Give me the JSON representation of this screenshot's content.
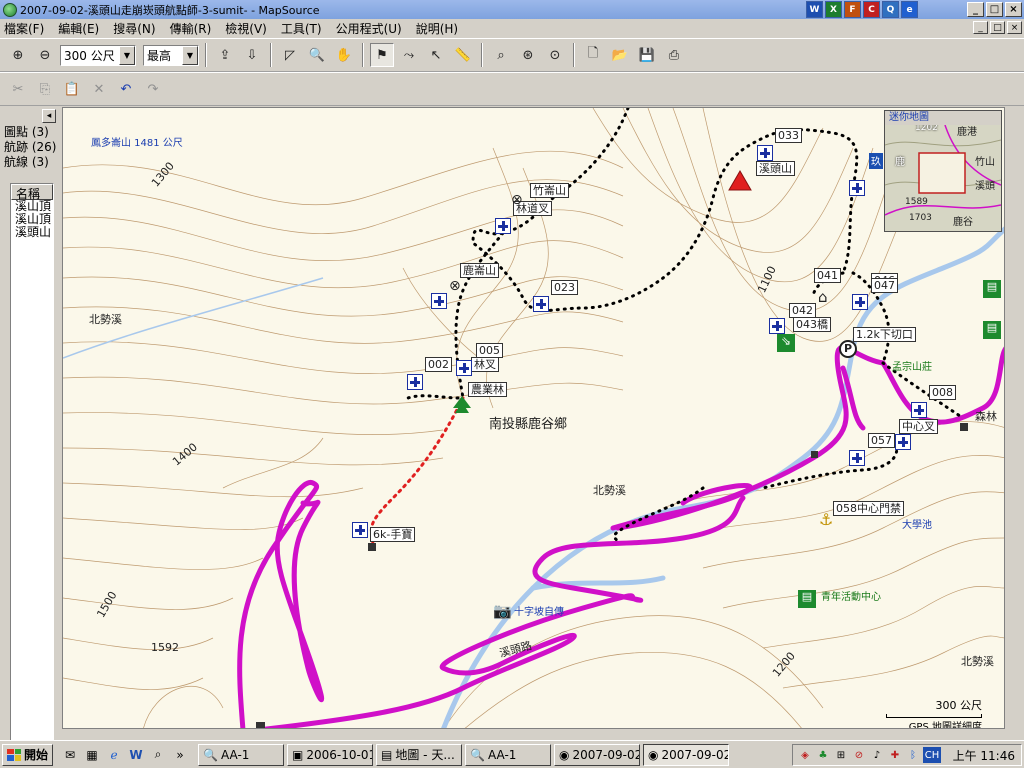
{
  "window": {
    "title": "2007-09-02-溪頭山走崩崁頭航點師-3-sumit- - MapSource",
    "min": "_",
    "max": "□",
    "close": "×"
  },
  "title_tray": [
    "W",
    "X",
    "F",
    "C",
    "Q",
    "e"
  ],
  "menu": [
    "檔案(F)",
    "編輯(E)",
    "搜尋(N)",
    "傳輸(R)",
    "檢視(V)",
    "工具(T)",
    "公用程式(U)",
    "說明(H)"
  ],
  "toolbar": {
    "zoom_value": "300 公尺",
    "detail_value": "最高"
  },
  "left_panel": {
    "tabs": [
      "圖點 (3)",
      "航跡 (26)",
      "航線 (3)"
    ],
    "list_header": "名稱",
    "list_items": [
      "溪山頂",
      "溪山頂",
      "溪頭山"
    ]
  },
  "map": {
    "places": {
      "peak_label": "鳳多崙山 1481 公尺",
      "contour_1300": "1300",
      "contour_1400": "1400",
      "contour_1500": "1500",
      "contour_1200": "1200",
      "contour_1100": "1100",
      "spot_height": "1592",
      "stream_west": "北勢溪",
      "stream_mid": "北勢溪",
      "stream_east": "北勢溪",
      "township": "南投縣鹿谷鄉",
      "road": "溪頭路"
    },
    "waypoints": {
      "w033": "033",
      "w023": "023",
      "w005": "005",
      "w002": "002",
      "w041": "041",
      "w042": "042",
      "w043": "043橋",
      "w046": "046",
      "w047": "047",
      "w008": "008",
      "w057": "057",
      "w058": "058中心門禁",
      "xitou": "溪頭山",
      "zhuqishan": "竹崙山",
      "linwen": "林道叉",
      "luling": "鹿崙山",
      "wen": "林叉",
      "chanlin": "農業林",
      "start": "6k-手寶",
      "trail_sign": "1.2k下切口",
      "center_wen": "中心叉",
      "fork": "森林"
    },
    "pois": {
      "hostel": "孟宗山莊",
      "pool": "大學池",
      "camera": "十字坡自傳",
      "youth": "青年活動中心"
    },
    "minimap": {
      "title": "迷你地圖",
      "labels": [
        "1202",
        "鹿港",
        "鹿",
        "竹山",
        "溪頭",
        "1589",
        "1703",
        "鹿谷",
        "溪",
        "溪頭"
      ]
    },
    "scale": {
      "label": "300 公尺",
      "sub": "GPS 地圖詳細度"
    }
  },
  "taskbar": {
    "start": "開始",
    "tasks": [
      "AA-1",
      "2006-10-01...",
      "地圖 - 天...",
      "AA-1",
      "2007-09-02...",
      "2007-09-02..."
    ],
    "active_task": 5,
    "tray_lang": "CH",
    "clock": "上午 11:46"
  },
  "colors": {
    "road": "#d010c8",
    "river": "#a8c8ec",
    "contour": "#b48a5a",
    "track_dotted": "#000000",
    "route_red": "#e02020",
    "waypoint": "#1a2fa0"
  }
}
